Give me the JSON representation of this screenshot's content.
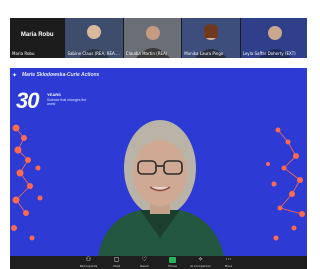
{
  "participants": {
    "active_speaker": "Maria Robu",
    "tiles": [
      {
        "name": "Maria Robu"
      },
      {
        "name": "Sabine Claus (REA, REA.B) (El..."
      },
      {
        "name": "Claudia Martin (REA)"
      },
      {
        "name": "Monika Laura Pingo"
      },
      {
        "name": "Leyla Saffar Doherty (EXT)"
      }
    ]
  },
  "background": {
    "brand": "Marie Skłodowska-Curie Actions",
    "anniversary_number": "30",
    "years_label": "YEARS",
    "tagline": "Science that changes the world"
  },
  "toolbar": {
    "items": [
      {
        "label": "Participants",
        "icon": "participants-icon"
      },
      {
        "label": "Chat",
        "icon": "chat-icon"
      },
      {
        "label": "React",
        "icon": "react-icon"
      },
      {
        "label": "Share",
        "icon": "share-icon"
      },
      {
        "label": "AI Companion",
        "icon": "ai-companion-icon"
      },
      {
        "label": "More",
        "icon": "more-icon"
      }
    ]
  },
  "colors": {
    "background_blue": "#2d3ad4",
    "accent_coral": "#ff6a4e",
    "toolbar_bg": "#1e1e1e"
  }
}
